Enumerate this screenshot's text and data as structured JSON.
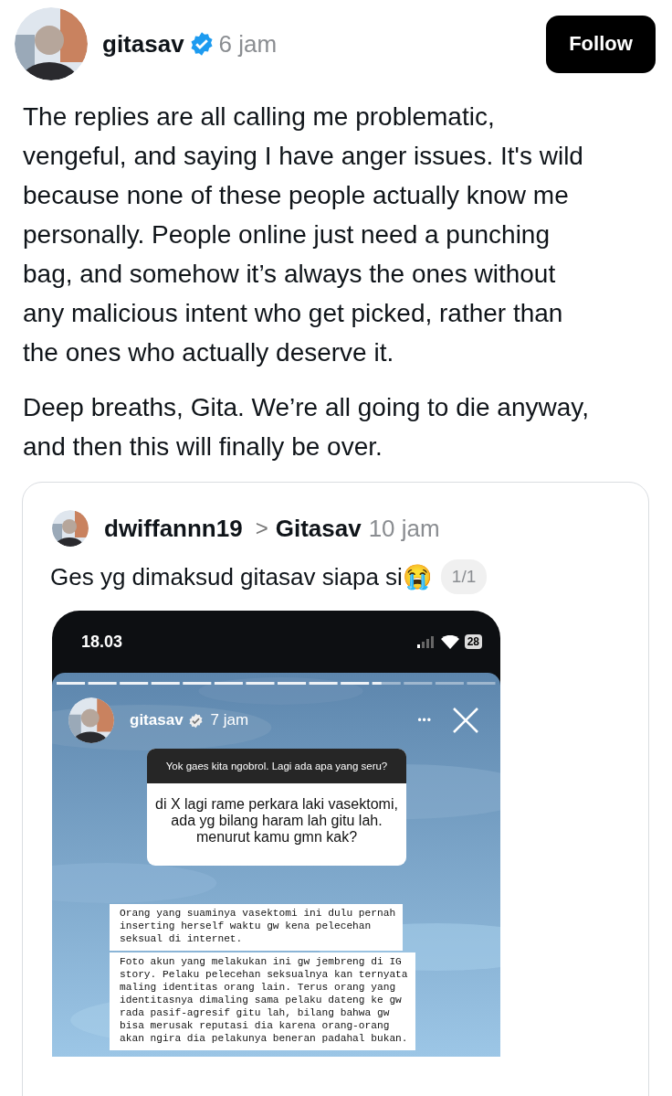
{
  "post": {
    "author": "gitasav",
    "verified": true,
    "time": "6 jam",
    "follow_button": "Follow",
    "paragraphs": [
      "The replies are all calling me problematic, vengeful, and saying I have anger issues. It's wild because none of these people actually know me personally. People online just need a punching bag, and somehow it’s always the ones without any malicious intent who get picked, rather than the ones who actually deserve it.",
      "Deep breaths, Gita. We’re all going to die anyway, and then this will finally be over."
    ]
  },
  "quoted": {
    "author": "dwiffannn19",
    "separator": ">",
    "reply_to": "Gitasav",
    "time": "10 jam",
    "text": "Ges yg dimaksud gitasav siapa si😭",
    "image_counter": "1/1",
    "screenshot": {
      "status_time": "18.03",
      "battery": "28",
      "story_author": "gitasav",
      "story_verified": true,
      "story_time": "7 jam",
      "more_icon": "•••",
      "question": {
        "prompt": "Yok gaes kita ngobrol. Lagi ada apa yang seru?",
        "answer": "di X lagi rame perkara laki vasektomi,\nada yg bilang haram lah  gitu lah.\nmenurut kamu gmn kak?"
      },
      "notes": [
        "Orang yang suaminya vasektomi ini dulu pernah\ninserting herself waktu gw kena pelecehan\nseksual di internet.",
        "Foto akun yang melakukan ini gw jembreng di IG\nstory. Pelaku pelecehan seksualnya kan ternyata\nmaling identitas orang lain. Terus orang yang\nidentitasnya dimaling sama pelaku dateng ke gw\nrada pasif-agresif gitu lah, bilang bahwa gw\nbisa merusak reputasi dia karena orang-orang\nakan ngira dia pelakunya beneran padahal bukan."
      ]
    }
  }
}
